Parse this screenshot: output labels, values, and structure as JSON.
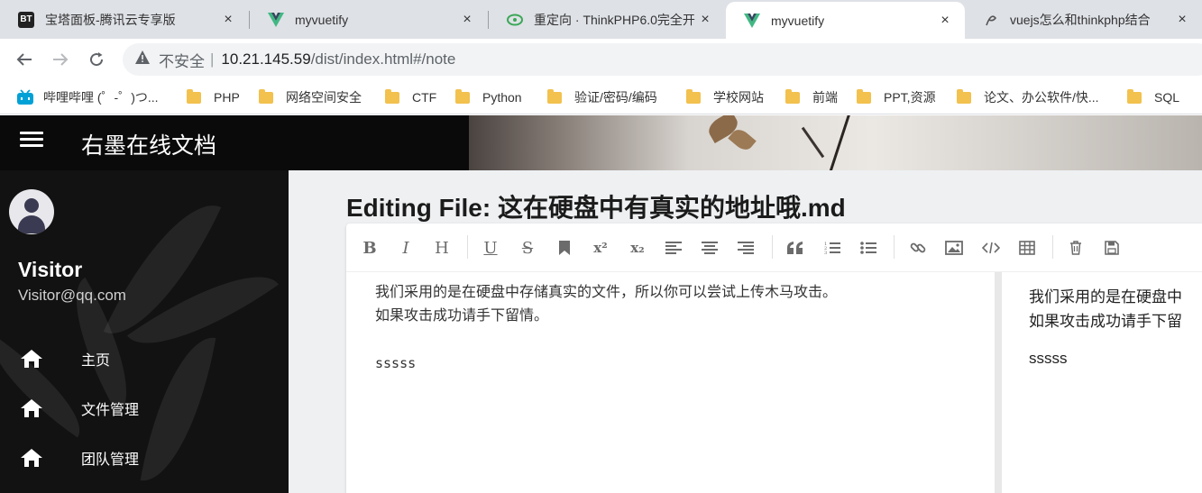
{
  "browser": {
    "tabs": [
      {
        "title": "宝塔面板-腾讯云专享版",
        "icon": "bt-panel-icon",
        "active": false
      },
      {
        "title": "myvuetify",
        "icon": "vue-icon",
        "active": false
      },
      {
        "title": "重定向 · ThinkPHP6.0完全开",
        "icon": "thinkphp-icon",
        "active": false
      },
      {
        "title": "myvuetify",
        "icon": "vue-icon",
        "active": true
      },
      {
        "title": "vuejs怎么和thinkphp结合",
        "icon": "page-icon",
        "active": false
      }
    ],
    "close_glyph": "×",
    "address": {
      "insecure_label": "不安全",
      "separator": "|",
      "host": "10.21.145.59",
      "path": "/dist/index.html#/note"
    },
    "bookmarks": [
      {
        "label": "哔哩哔哩 (゜-゜)つ...",
        "icon": "bilibili-icon"
      },
      {
        "label": "PHP",
        "icon": "folder-icon"
      },
      {
        "label": "网络空间安全",
        "icon": "folder-icon"
      },
      {
        "label": "CTF",
        "icon": "folder-icon"
      },
      {
        "label": "Python",
        "icon": "folder-icon"
      },
      {
        "label": "验证/密码/编码",
        "icon": "folder-icon"
      },
      {
        "label": "学校网站",
        "icon": "folder-icon"
      },
      {
        "label": "前端",
        "icon": "folder-icon"
      },
      {
        "label": "PPT,资源",
        "icon": "folder-icon"
      },
      {
        "label": "论文、办公软件/快...",
        "icon": "folder-icon"
      },
      {
        "label": "SQL",
        "icon": "folder-icon"
      }
    ]
  },
  "app": {
    "title": "右墨在线文档",
    "user": {
      "name": "Visitor",
      "email": "Visitor@qq.com"
    },
    "nav": [
      {
        "label": "主页",
        "icon": "home-icon"
      },
      {
        "label": "文件管理",
        "icon": "home-icon"
      },
      {
        "label": "团队管理",
        "icon": "home-icon"
      }
    ]
  },
  "editor": {
    "page_title": "Editing File: 这在硬盘中有真实的地址哦.md",
    "toolbar": [
      "bold",
      "italic",
      "header",
      "underline",
      "strikethrough",
      "mark",
      "superscript",
      "subscript",
      "align-left",
      "align-center",
      "align-right",
      "quote",
      "ordered-list",
      "unordered-list",
      "link",
      "image",
      "code",
      "table",
      "trash",
      "save"
    ],
    "toolbar_glyphs": {
      "bold": "B",
      "italic": "I",
      "header": "H",
      "underline": "U",
      "strikethrough": "S",
      "superscript": "x²",
      "subscript": "x₂"
    },
    "content_lines": [
      "我们采用的是在硬盘中存储真实的文件，所以你可以尝试上传木马攻击。",
      "如果攻击成功请手下留情。",
      "",
      "sssss"
    ],
    "preview_lines": [
      "我们采用的是在硬盘中",
      "如果攻击成功请手下留"
    ],
    "preview_paragraph": "sssss"
  }
}
